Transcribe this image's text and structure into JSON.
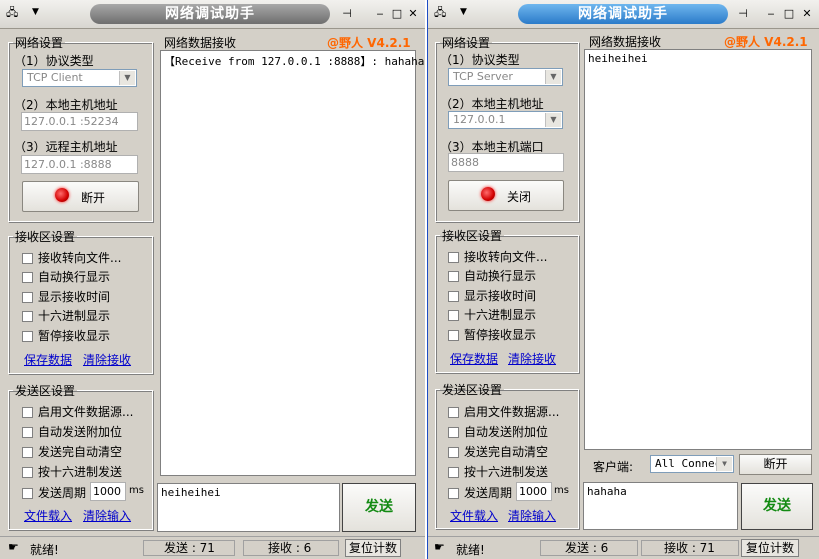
{
  "left": {
    "title": "网络调试助手",
    "version": "@野人 V4.2.1",
    "net_settings": {
      "legend": "网络设置",
      "protocol_label": "（1）协议类型",
      "protocol_value": "TCP Client",
      "local_label": "（2）本地主机地址",
      "local_value": "127.0.0.1 :52234",
      "remote_label": "（3）远程主机地址",
      "remote_value": "127.0.0.1 :8888",
      "connect_label": "断开"
    },
    "recv_settings": {
      "legend": "接收区设置",
      "options": [
        "接收转向文件...",
        "自动换行显示",
        "显示接收时间",
        "十六进制显示",
        "暂停接收显示"
      ],
      "save_link": "保存数据",
      "clear_link": "清除接收"
    },
    "send_settings": {
      "legend": "发送区设置",
      "options": [
        "启用文件数据源...",
        "自动发送附加位",
        "发送完自动清空",
        "按十六进制发送"
      ],
      "period_label": "发送周期",
      "period_value": "1000",
      "period_unit": "ms",
      "load_link": "文件载入",
      "clear_link": "清除输入"
    },
    "recv_title": "网络数据接收",
    "recv_text": "【Receive from 127.0.0.1 :8888】: hahaha",
    "send_text": "heiheihei",
    "send_button": "发送",
    "status": {
      "ready": "就绪!",
      "sent_label": "发送 : 71",
      "recv_label": "接收 : 6",
      "reset": "复位计数"
    }
  },
  "right": {
    "title": "网络调试助手",
    "version": "@野人 V4.2.1",
    "net_settings": {
      "legend": "网络设置",
      "protocol_label": "（1）协议类型",
      "protocol_value": "TCP Server",
      "local_label": "（2）本地主机地址",
      "local_value": "127.0.0.1",
      "port_label": "（3）本地主机端口",
      "port_value": "8888",
      "connect_label": "关闭"
    },
    "recv_settings": {
      "legend": "接收区设置",
      "options": [
        "接收转向文件...",
        "自动换行显示",
        "显示接收时间",
        "十六进制显示",
        "暂停接收显示"
      ],
      "save_link": "保存数据",
      "clear_link": "清除接收"
    },
    "send_settings": {
      "legend": "发送区设置",
      "options": [
        "启用文件数据源...",
        "自动发送附加位",
        "发送完自动清空",
        "按十六进制发送"
      ],
      "period_label": "发送周期",
      "period_value": "1000",
      "period_unit": "ms",
      "load_link": "文件载入",
      "clear_link": "清除输入"
    },
    "recv_title": "网络数据接收",
    "recv_text": "heiheihei",
    "client_label": "客户端:",
    "client_value": "All Connec",
    "disconnect_button": "断开",
    "send_text": "hahaha",
    "send_button": "发送",
    "status": {
      "ready": "就绪!",
      "sent_label": "发送 : 6",
      "recv_label": "接收 : 71",
      "reset": "复位计数"
    }
  }
}
